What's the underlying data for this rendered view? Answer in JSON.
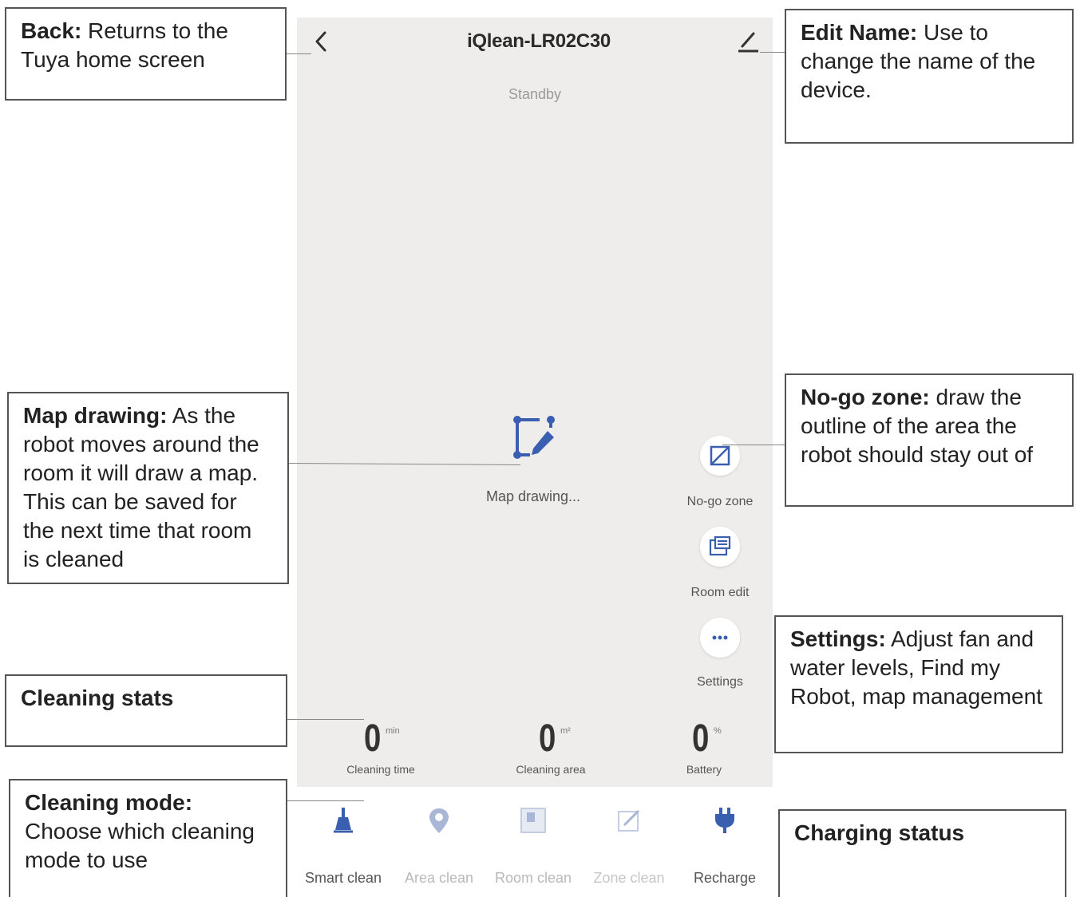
{
  "header": {
    "device_name": "iQlean-LR02C30",
    "status": "Standby"
  },
  "map": {
    "status_text": "Map drawing..."
  },
  "side_buttons": [
    {
      "label": "No-go zone"
    },
    {
      "label": "Room edit"
    },
    {
      "label": "Settings"
    }
  ],
  "stats": [
    {
      "value": "0",
      "unit": "min",
      "label": "Cleaning time"
    },
    {
      "value": "0",
      "unit": "m²",
      "label": "Cleaning area"
    },
    {
      "value": "0",
      "unit": "%",
      "label": "Battery"
    }
  ],
  "modes": [
    {
      "label": "Smart clean",
      "active": true
    },
    {
      "label": "Area clean",
      "active": false
    },
    {
      "label": "Room clean",
      "active": false
    },
    {
      "label": "Zone clean",
      "active": false
    },
    {
      "label": "Recharge",
      "active": true
    }
  ],
  "callouts": {
    "back": {
      "title": "Back:",
      "text": " Returns to the Tuya home screen"
    },
    "edit_name": {
      "title": "Edit Name:",
      "text": " Use to change the name of the device."
    },
    "map_drawing": {
      "title": "Map drawing:",
      "text": " As the robot moves around the room it will draw a map. This can be saved for the next time that room is cleaned"
    },
    "no_go_zone": {
      "title": "No-go zone:",
      "text": " draw the outline of the area the robot should stay out of"
    },
    "cleaning_stats": {
      "title": "Cleaning stats",
      "text": ""
    },
    "settings": {
      "title": "Settings:",
      "text": " Adjust fan and water levels, Find my Robot, map management"
    },
    "cleaning_mode": {
      "title": "Cleaning mode:",
      "text": " Choose which cleaning mode to use"
    },
    "charging_status": {
      "title": "Charging status",
      "text": ""
    }
  },
  "colors": {
    "accent": "#3b5fb0",
    "inactive": "#a9b6d6",
    "screen_bg": "#efedeb"
  }
}
